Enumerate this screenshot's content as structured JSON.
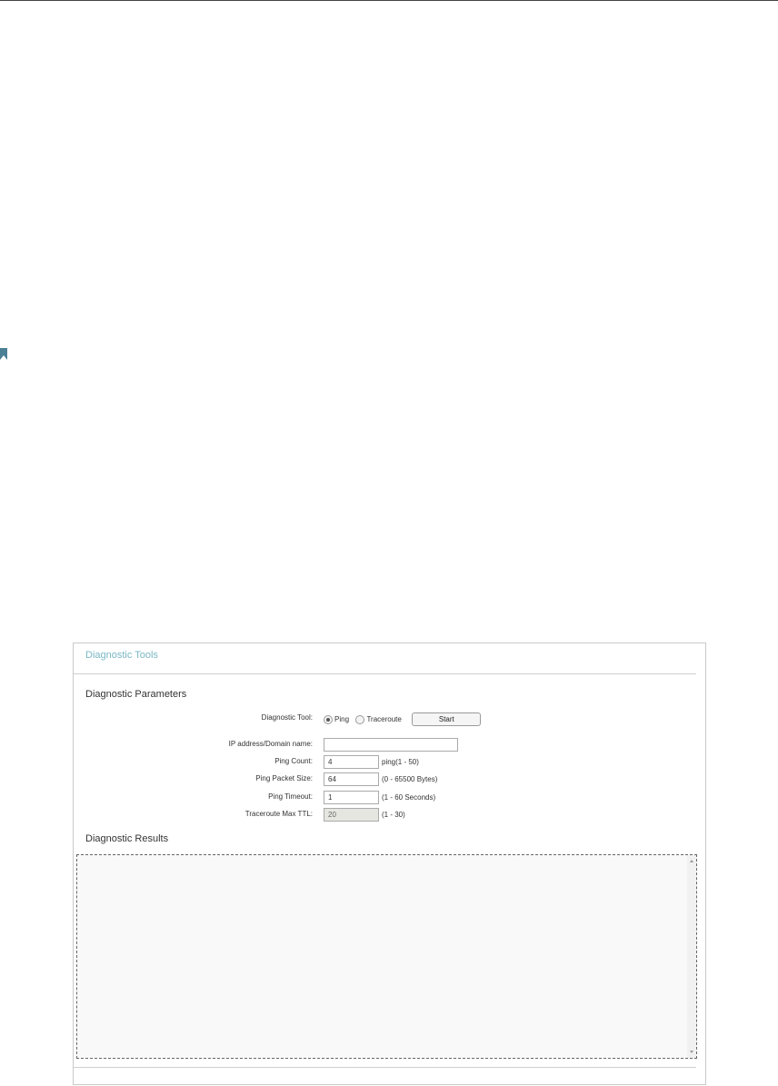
{
  "panel": {
    "title": "Diagnostic Tools",
    "parameters_title": "Diagnostic Parameters",
    "results_title": "Diagnostic Results"
  },
  "params": {
    "tool_label": "Diagnostic Tool:",
    "tool_options": [
      "Ping",
      "Traceroute"
    ],
    "tool_selected": "Ping",
    "start_label": "Start",
    "ip_label": "IP address/Domain name:",
    "ip_value": "",
    "ping_count_label": "Ping Count:",
    "ping_count_value": "4",
    "ping_count_hint": "ping(1 - 50)",
    "packet_size_label": "Ping Packet Size:",
    "packet_size_value": "64",
    "packet_size_hint": "(0 - 65500 Bytes)",
    "timeout_label": "Ping Timeout:",
    "timeout_value": "1",
    "timeout_hint": "(1 - 60 Seconds)",
    "ttl_label": "Traceroute Max TTL:",
    "ttl_value": "20",
    "ttl_hint": "(1 - 30)"
  },
  "results": {
    "text": ""
  },
  "colors": {
    "accent": "#7ab7c4",
    "bookmark": "#4a7f95"
  },
  "icons": {
    "bookmark": "bookmark-icon"
  }
}
